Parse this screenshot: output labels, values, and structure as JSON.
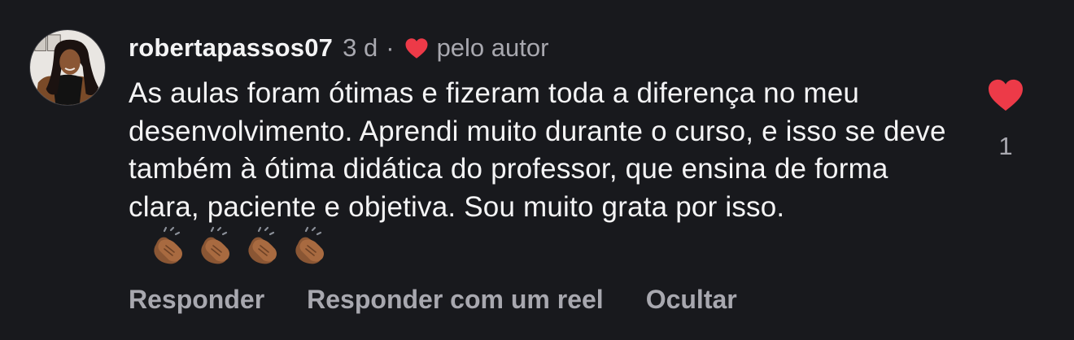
{
  "comment": {
    "username": "robertapassos07",
    "time": "3 d",
    "separator": "·",
    "liked_by_author_label": "pelo autor",
    "text": "As aulas foram ótimas e fizeram toda a diferença no meu desenvolvimento. Aprendi muito durante o curso, e isso se deve também à ótima didática do professor, que ensina de forma clara, paciente e objetiva. Sou muito grata por isso.",
    "emojis": [
      "clapping-hands",
      "clapping-hands",
      "clapping-hands",
      "clapping-hands"
    ],
    "like_count": "1",
    "liked": true
  },
  "actions": {
    "reply": "Responder",
    "reply_with_reel": "Responder com um reel",
    "hide": "Ocultar"
  },
  "colors": {
    "background": "#18191d",
    "text_primary": "#f4f4f5",
    "text_secondary": "#a8a8af",
    "heart": "#ed3a48"
  }
}
